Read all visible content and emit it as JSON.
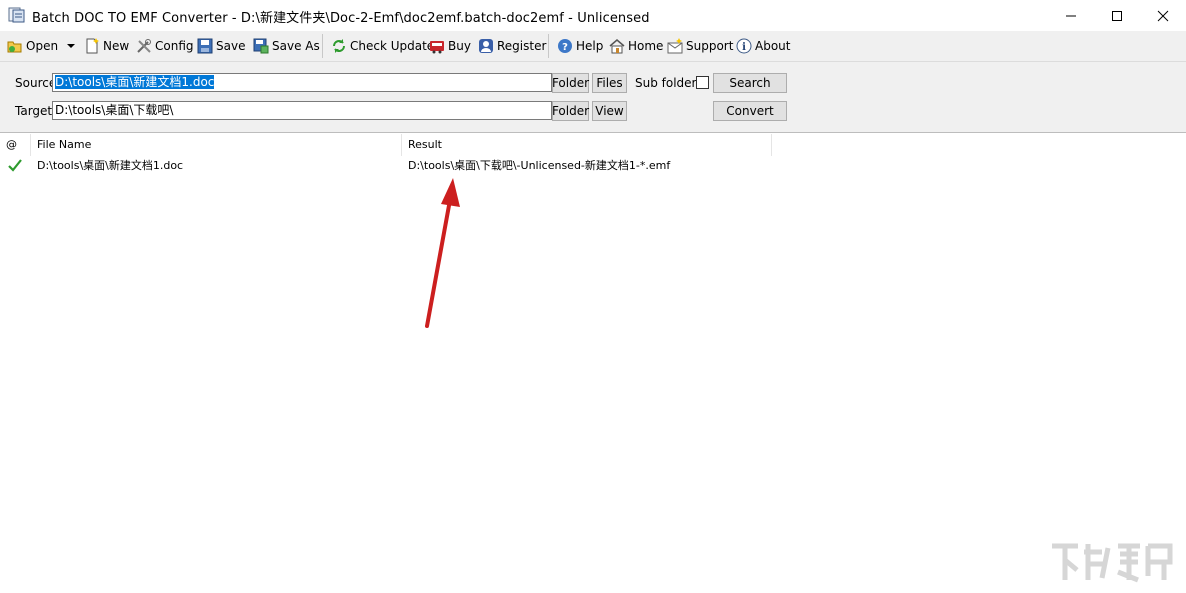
{
  "window": {
    "title": "Batch DOC TO EMF Converter - D:\\新建文件夹\\Doc-2-Emf\\doc2emf.batch-doc2emf - Unlicensed"
  },
  "toolbar": {
    "open": "Open",
    "new": "New",
    "config": "Config",
    "save": "Save",
    "save_as": "Save As",
    "check_update": "Check Update",
    "buy": "Buy",
    "register": "Register",
    "help": "Help",
    "home": "Home",
    "support": "Support",
    "about": "About"
  },
  "source": {
    "label": "Source",
    "value": "D:\\tools\\桌面\\新建文档1.doc",
    "folder_button": "Folder",
    "files_button": "Files",
    "subfolders_label": "Sub folders",
    "subfolders_checked": false,
    "search_button": "Search"
  },
  "target": {
    "label": "Target",
    "value": "D:\\tools\\桌面\\下载吧\\",
    "folder_button": "Folder",
    "view_button": "View",
    "convert_button": "Convert"
  },
  "grid": {
    "columns": [
      "@",
      "File Name",
      "Result"
    ],
    "rows": [
      {
        "status": "ok",
        "file_name": "D:\\tools\\桌面\\新建文档1.doc",
        "result": "D:\\tools\\桌面\\下载吧\\-Unlicensed-新建文档1-*.emf"
      }
    ]
  },
  "colors": {
    "selection": "#0078d7",
    "arrow": "#cc1f1f",
    "check": "#2e9b2e"
  }
}
